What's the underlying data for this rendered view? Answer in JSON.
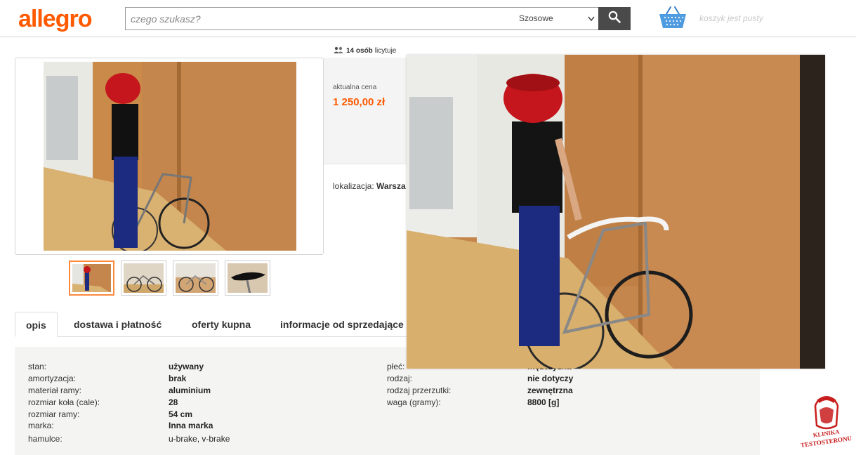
{
  "header": {
    "logo": "allegro",
    "search_placeholder": "czego szukasz?",
    "category": "Szosowe",
    "cart_text": "koszyk jest pusty",
    "search_icon": "search-icon",
    "cart_icon": "basket-icon"
  },
  "offer": {
    "bidders_count": "14 osób",
    "bidders_suffix": "licytuje",
    "price_label": "aktualna cena",
    "price_value": "1 250,00 zł",
    "location_label": "lokalizacja:",
    "location_value": "Warsza"
  },
  "gallery": {
    "thumbnails": [
      "thumb-1",
      "thumb-2",
      "thumb-3",
      "thumb-4"
    ],
    "active_index": 0
  },
  "tabs": [
    {
      "label": "opis",
      "active": true
    },
    {
      "label": "dostawa i płatność",
      "active": false
    },
    {
      "label": "oferty kupna",
      "active": false
    },
    {
      "label": "informacje od sprzedające",
      "active": false
    }
  ],
  "params_left": [
    {
      "name": "stan:",
      "value": "używany"
    },
    {
      "name": "amortyzacja:",
      "value": "brak"
    },
    {
      "name": "materiał ramy:",
      "value": "aluminium"
    },
    {
      "name": "rozmiar koła (cale):",
      "value": "28"
    },
    {
      "name": "rozmiar ramy:",
      "value": "54 cm"
    },
    {
      "name": "marka:",
      "value": "Inna marka"
    },
    {
      "name": "hamulce:",
      "value": "u-brake, v-brake"
    }
  ],
  "params_right": [
    {
      "name": "płeć:",
      "value": "mężczyzna"
    },
    {
      "name": "rodzaj:",
      "value": "nie dotyczy"
    },
    {
      "name": "rodzaj przerzutki:",
      "value": "zewnętrzna"
    },
    {
      "name": "waga (gramy):",
      "value": "8800 [g]"
    }
  ],
  "watermark": {
    "line1": "KLINIKA",
    "line2": "TESTOSTERONU"
  },
  "colors": {
    "brand": "#ff5a00",
    "price": "#ff5a00",
    "thumb_active": "#ff8a3d"
  }
}
